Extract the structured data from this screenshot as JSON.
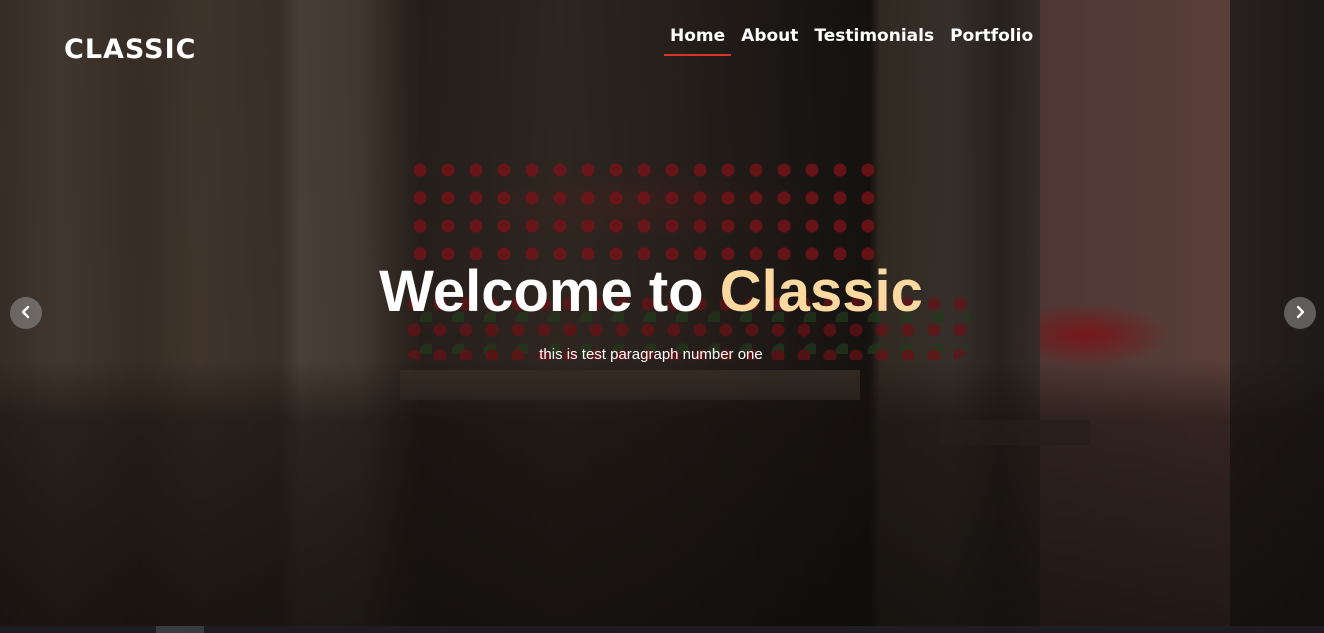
{
  "brand": {
    "logo": "CLASSIC"
  },
  "nav": {
    "items": [
      {
        "label": "Home",
        "active": true
      },
      {
        "label": "About",
        "active": false
      },
      {
        "label": "Testimonials",
        "active": false
      },
      {
        "label": "Portfolio",
        "active": false
      }
    ]
  },
  "hero": {
    "headline_prefix": "Welcome to ",
    "headline_accent": "Classic",
    "subtitle": "this is test paragraph number one",
    "prev_icon": "chevron-left-icon",
    "next_icon": "chevron-right-icon"
  },
  "colors": {
    "accent": "#fbd9a1",
    "nav_underline": "#d9342b"
  }
}
